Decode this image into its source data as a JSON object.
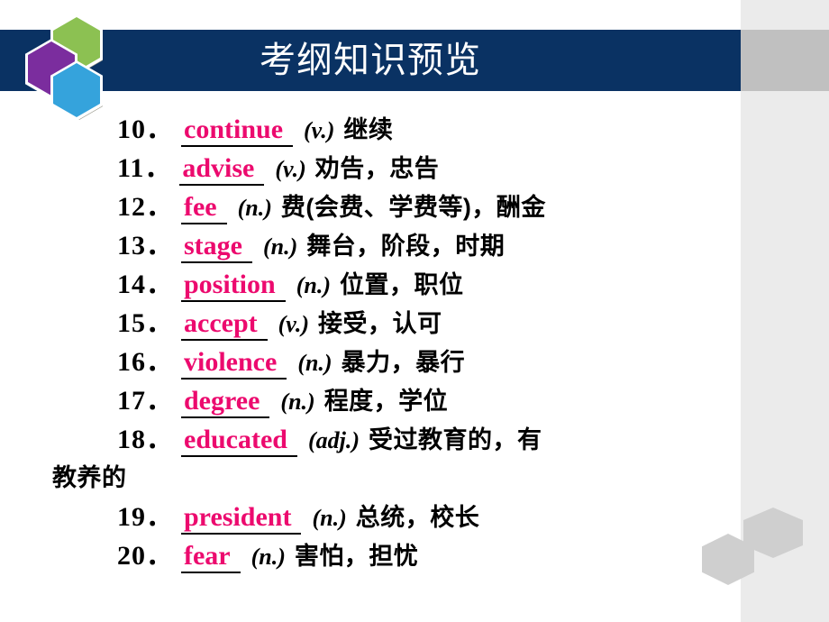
{
  "header": {
    "title": "考纲知识预览",
    "bar_color": "#0a3263",
    "title_color": "#ffffff"
  },
  "logo": {
    "hex_green_color": "#8cc152",
    "hex_purple_color": "#7b2d9e",
    "hex_blue_color": "#35a3dc"
  },
  "decor": {
    "right_column_color": "#ebebeb",
    "right_band_color": "#c0c0c0",
    "hex_gray_color": "#cfcfcf"
  },
  "vocab": {
    "word_color": "#ec0a6e",
    "items": [
      {
        "num": "10．",
        "word": "continue",
        "pos": "(v.)",
        "cn": "继续"
      },
      {
        "num": "11．",
        "word": "advise",
        "pos": "(v.)",
        "cn": "劝告，忠告"
      },
      {
        "num": "12．",
        "word": "fee",
        "pos": "(n.)",
        "cn": "费(会费、学费等)，酬金"
      },
      {
        "num": "13．",
        "word": "stage",
        "pos": "(n.)",
        "cn": "舞台，阶段，时期"
      },
      {
        "num": "14．",
        "word": "position",
        "pos": "(n.)",
        "cn": "位置，职位"
      },
      {
        "num": "15．",
        "word": "accept",
        "pos": "(v.)",
        "cn": "接受，认可"
      },
      {
        "num": "16．",
        "word": "violence",
        "pos": "(n.)",
        "cn": "暴力，暴行"
      },
      {
        "num": "17．",
        "word": "degree",
        "pos": "(n.)",
        "cn": "程度，学位"
      },
      {
        "num": "18．",
        "word": "educated",
        "pos": "(adj.)",
        "cn": "受过教育的，有",
        "cn_wrap": "教养的"
      },
      {
        "num": "19．",
        "word": "president",
        "pos": "(n.)",
        "cn": "总统，校长"
      },
      {
        "num": "20．",
        "word": "fear",
        "pos": "(n.)",
        "cn": "害怕，担忧"
      }
    ]
  }
}
